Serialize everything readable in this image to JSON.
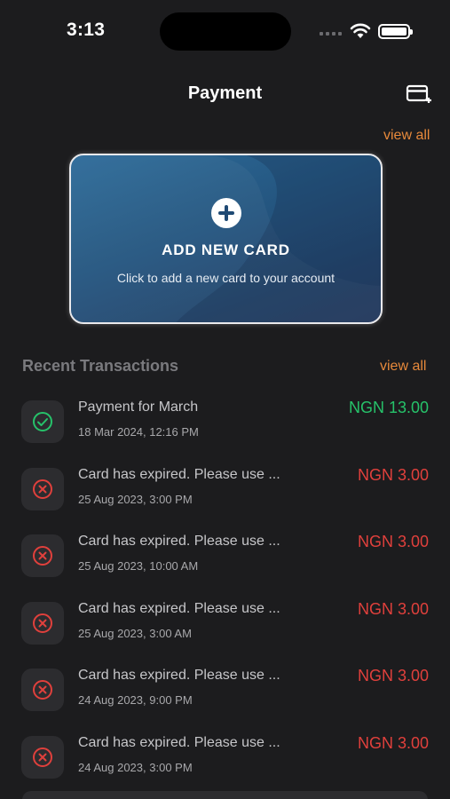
{
  "status_bar": {
    "time": "3:13"
  },
  "header": {
    "title": "Payment",
    "action_icon": "add-card-icon"
  },
  "cards": {
    "view_all": "view all",
    "add_card": {
      "title": "ADD NEW CARD",
      "subtitle": "Click to add a new card to your account",
      "icon": "plus-circle-icon"
    }
  },
  "transactions": {
    "title": "Recent Transactions",
    "view_all": "view all",
    "items": [
      {
        "description": "Payment for March",
        "date": "18 Mar 2024, 12:16 PM",
        "amount": "NGN 13.00",
        "status": "success"
      },
      {
        "description": "Card has expired. Please use ...",
        "date": "25 Aug 2023, 3:00 PM",
        "amount": "NGN 3.00",
        "status": "failed"
      },
      {
        "description": "Card has expired. Please use ...",
        "date": "25 Aug 2023, 10:00 AM",
        "amount": "NGN 3.00",
        "status": "failed"
      },
      {
        "description": "Card has expired. Please use ...",
        "date": "25 Aug 2023, 3:00 AM",
        "amount": "NGN 3.00",
        "status": "failed"
      },
      {
        "description": "Card has expired. Please use ...",
        "date": "24 Aug 2023, 9:00 PM",
        "amount": "NGN 3.00",
        "status": "failed"
      },
      {
        "description": "Card has expired. Please use ...",
        "date": "24 Aug 2023, 3:00 PM",
        "amount": "NGN 3.00",
        "status": "failed"
      }
    ]
  },
  "colors": {
    "background": "#1c1c1e",
    "accent": "#e7893b",
    "success": "#26c26a",
    "failed": "#e0403c"
  }
}
